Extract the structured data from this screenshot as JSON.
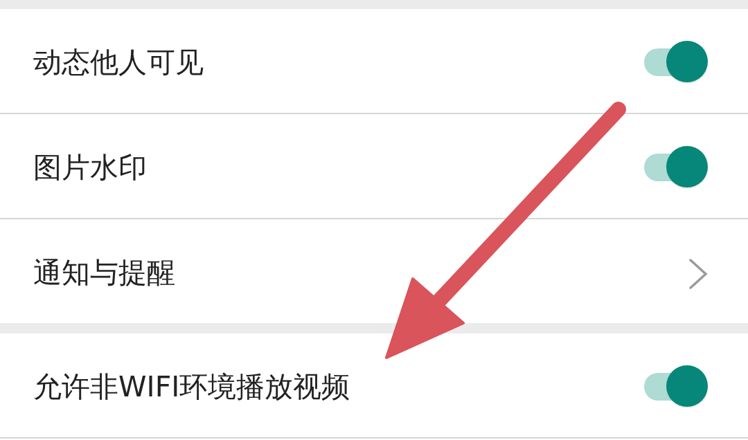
{
  "sections": [
    {
      "items": [
        {
          "label": "动态他人可见",
          "kind": "toggle",
          "on": true
        },
        {
          "label": "图片水印",
          "kind": "toggle",
          "on": true
        },
        {
          "label": "通知与提醒",
          "kind": "link"
        }
      ]
    },
    {
      "items": [
        {
          "label": "允许非WIFI环境播放视频",
          "kind": "toggle",
          "on": true
        }
      ]
    }
  ]
}
